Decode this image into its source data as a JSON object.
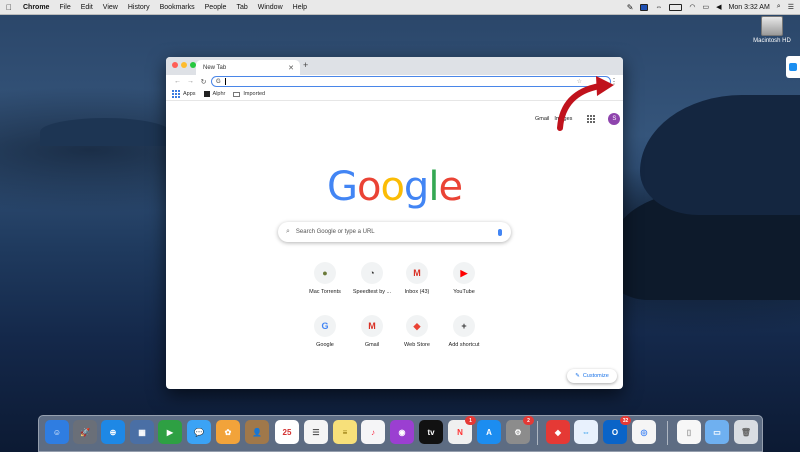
{
  "menubar": {
    "app": "Chrome",
    "items": [
      "File",
      "Edit",
      "View",
      "History",
      "Bookmarks",
      "People",
      "Tab",
      "Window",
      "Help"
    ],
    "clock": "Mon 3:32 AM"
  },
  "desktop": {
    "drive_label": "Macintosh HD"
  },
  "browser": {
    "tab_title": "New Tab",
    "omnibox_prefix": "G",
    "bookmarks": [
      "Apps",
      "Alphr",
      "Imported"
    ]
  },
  "page": {
    "links": {
      "gmail": "Gmail",
      "images": "Images"
    },
    "avatar_letter": "S",
    "logo": [
      "G",
      "o",
      "o",
      "g",
      "l",
      "e"
    ],
    "logo_colors": [
      "#4285f4",
      "#ea4335",
      "#fbbc05",
      "#4285f4",
      "#34a853",
      "#ea4335"
    ],
    "search_placeholder": "Search Google or type a URL",
    "shortcuts": [
      {
        "label": "Mac Torrents",
        "glyph": "●",
        "color": "#6b7a3a"
      },
      {
        "label": "Speedtest by ...",
        "glyph": "◔",
        "color": "#333333"
      },
      {
        "label": "Inbox (43)",
        "glyph": "M",
        "color": "#d93025"
      },
      {
        "label": "YouTube",
        "glyph": "▶",
        "color": "#ff0000"
      },
      {
        "label": "Google",
        "glyph": "G",
        "color": "#4285f4"
      },
      {
        "label": "Gmail",
        "glyph": "M",
        "color": "#d93025"
      },
      {
        "label": "Web Store",
        "glyph": "◆",
        "color": "#ea4335"
      },
      {
        "label": "Add shortcut",
        "glyph": "+",
        "color": "#333333"
      }
    ],
    "customize": "Customize"
  },
  "dock": {
    "apps": [
      {
        "name": "finder",
        "color": "#2f7de1",
        "glyph": "☺"
      },
      {
        "name": "launchpad",
        "color": "#6a6f78",
        "glyph": "🚀"
      },
      {
        "name": "safari",
        "color": "#1e88e5",
        "glyph": "⊕"
      },
      {
        "name": "preview",
        "color": "#4a6fa5",
        "glyph": "▦"
      },
      {
        "name": "facetime",
        "color": "#2ea043",
        "glyph": "▶"
      },
      {
        "name": "messages",
        "color": "#3ba3f5",
        "glyph": "💬"
      },
      {
        "name": "photos",
        "color": "#f2a33a",
        "glyph": "✿"
      },
      {
        "name": "contacts",
        "color": "#a0784a",
        "glyph": "👤"
      },
      {
        "name": "calendar",
        "color": "#ffffff",
        "glyph": "25",
        "text": "#d32f2f"
      },
      {
        "name": "reminders",
        "color": "#f5f5f5",
        "glyph": "☰",
        "text": "#555"
      },
      {
        "name": "notes",
        "color": "#f7e07a",
        "glyph": "≡",
        "text": "#8a6d00"
      },
      {
        "name": "music",
        "color": "#f5f5f7",
        "glyph": "♪",
        "text": "#fa2d48"
      },
      {
        "name": "podcasts",
        "color": "#9b3fd1",
        "glyph": "◉"
      },
      {
        "name": "apple-tv",
        "color": "#111111",
        "glyph": "tv"
      },
      {
        "name": "news",
        "color": "#f0f0f0",
        "glyph": "N",
        "text": "#f33",
        "badge": "1"
      },
      {
        "name": "app-store",
        "color": "#1c8df0",
        "glyph": "A"
      },
      {
        "name": "system-preferences",
        "color": "#8c8c8c",
        "glyph": "⚙",
        "badge": "2"
      },
      {
        "name": "anydesk",
        "color": "#e53935",
        "glyph": "◆"
      },
      {
        "name": "teamviewer",
        "color": "#e8f1fd",
        "glyph": "⇔",
        "text": "#0e8ee9"
      },
      {
        "name": "outlook",
        "color": "#0a64c8",
        "glyph": "O",
        "badge": "32"
      },
      {
        "name": "chrome",
        "color": "#f5f5f5",
        "glyph": "◎",
        "text": "#4285f4"
      },
      {
        "name": "document",
        "color": "#f7f7f7",
        "glyph": "▯",
        "text": "#999"
      },
      {
        "name": "folder",
        "color": "#6fb0f0",
        "glyph": "▭"
      },
      {
        "name": "trash",
        "color": "#d9dde2",
        "glyph": "🗑",
        "text": "#666"
      }
    ]
  }
}
